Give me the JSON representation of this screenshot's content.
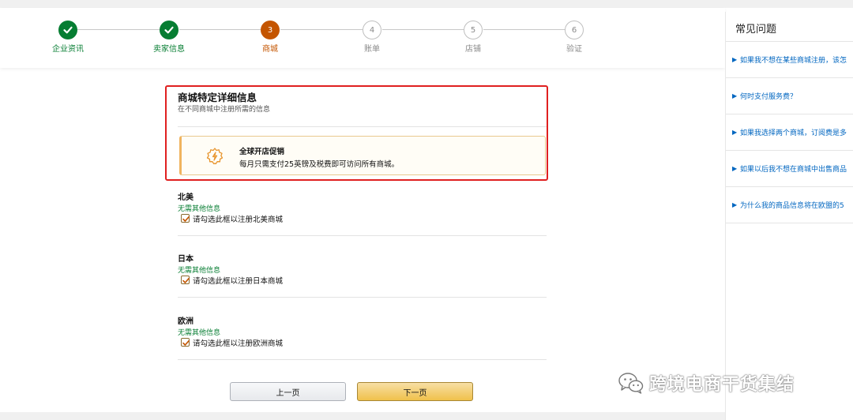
{
  "stepper": {
    "steps": [
      {
        "number": "1",
        "label": "企业资讯",
        "state": "done"
      },
      {
        "number": "2",
        "label": "卖家信息",
        "state": "done"
      },
      {
        "number": "3",
        "label": "商城",
        "state": "active"
      },
      {
        "number": "4",
        "label": "账单",
        "state": "todo"
      },
      {
        "number": "5",
        "label": "店铺",
        "state": "todo"
      },
      {
        "number": "6",
        "label": "验证",
        "state": "todo"
      }
    ]
  },
  "section": {
    "title": "商城特定详细信息",
    "subtitle": "在不同商城中注册所需的信息"
  },
  "promo": {
    "icon": "badge-icon",
    "title": "全球开店促销",
    "body": "每月只需支付25英镑及税费即可访问所有商城。"
  },
  "regions": [
    {
      "name": "北美",
      "note": "无需其他信息",
      "checkbox_label": "请勾选此框以注册北美商城",
      "checked": true
    },
    {
      "name": "日本",
      "note": "无需其他信息",
      "checkbox_label": "请勾选此框以注册日本商城",
      "checked": true
    },
    {
      "name": "欧洲",
      "note": "无需其他信息",
      "checkbox_label": "请勾选此框以注册欧洲商城",
      "checked": true
    }
  ],
  "buttons": {
    "prev_label": "上一页",
    "next_label": "下一页"
  },
  "faq": {
    "title": "常见问题",
    "items": [
      {
        "text": "如果我不想在某些商城注册，该怎"
      },
      {
        "text": "何时支付服务费？"
      },
      {
        "text": "如果我选择两个商城，订阅费是多"
      },
      {
        "text": "如果以后我不想在商城中出售商品"
      },
      {
        "text": "为什么我的商品信息将在欧盟的5"
      }
    ]
  },
  "watermark": {
    "text": "跨境电商干货集结",
    "icon": "wechat-icon"
  },
  "colors": {
    "done_green": "#067d32",
    "active_orange": "#c45500",
    "link_blue": "#0066c0",
    "highlight_red": "#e02020",
    "next_button": "#f0c14b"
  }
}
